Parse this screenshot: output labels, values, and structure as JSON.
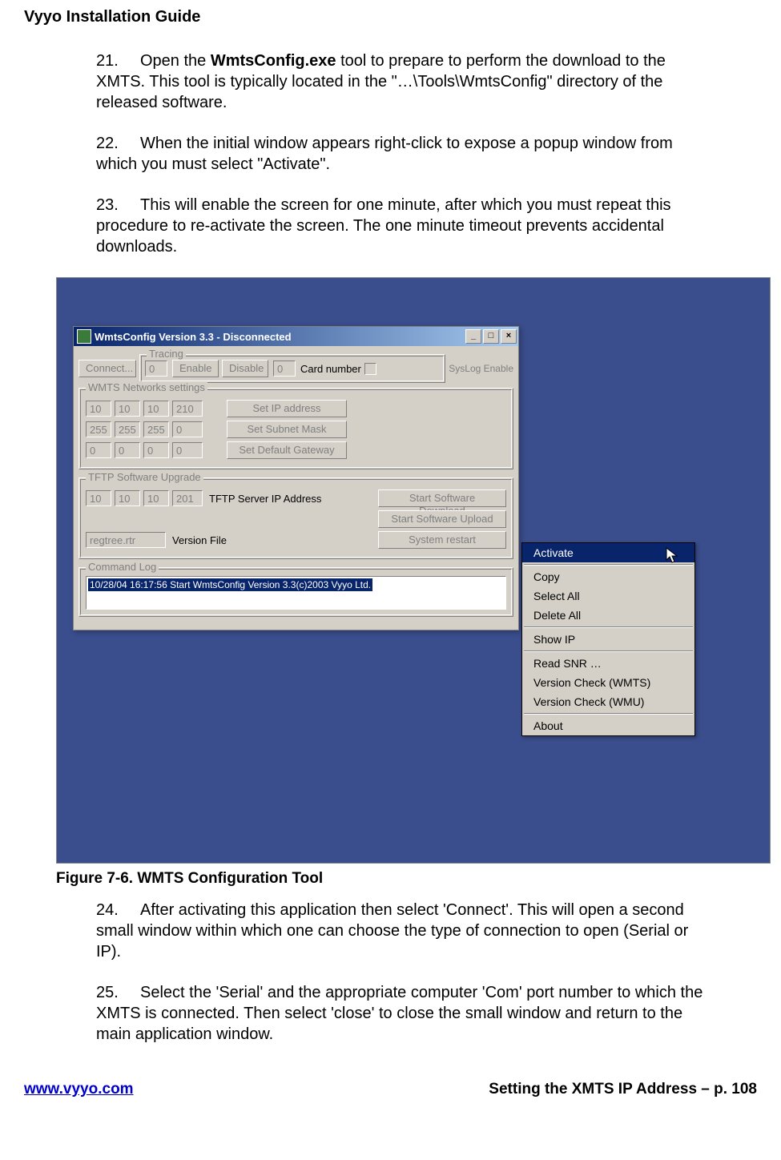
{
  "header_title": "Vyyo Installation Guide",
  "items": {
    "i21_num": "21.",
    "i21_a": "Open the ",
    "i21_bold": "WmtsConfig.exe",
    "i21_b": " tool to prepare to perform the download to the XMTS.  This tool is typically located in the \"…\\Tools\\WmtsConfig\" directory of the released software.",
    "i22_num": "22.",
    "i22": "When the initial window appears right-click to expose a popup window from which you must select \"Activate\".",
    "i23_num": "23.",
    "i23": "This will enable the screen for one minute, after which you must repeat this procedure to re-activate the screen. The one minute timeout prevents accidental downloads.",
    "i24_num": "24.",
    "i24": "After activating this application then select 'Connect'. This will open a second small window within which one can choose the type of connection to open (Serial or IP).",
    "i25_num": "25.",
    "i25": "Select the 'Serial' and the appropriate computer 'Com' port number to which the XMTS is connected. Then select 'close' to close the small window and return to the main application window."
  },
  "figure_caption": "Figure 7-6. WMTS Configuration Tool",
  "footer_link": "www.vyyo.com",
  "footer_right": "Setting the XMTS IP Address – p. 108",
  "win": {
    "title": "WmtsConfig Version 3.3 - Disconnected",
    "connect": "Connect...",
    "tracing_label": "Tracing",
    "tracing_val": "0",
    "enable": "Enable",
    "disable": "Disable",
    "cardnum_val": "0",
    "cardnum_label": "Card number",
    "syslog": "SysLog Enable",
    "net_label": "WMTS Networks settings",
    "ip1": "10",
    "ip2": "10",
    "ip3": "10",
    "ip4": "210",
    "set_ip": "Set IP address",
    "sm1": "255",
    "sm2": "255",
    "sm3": "255",
    "sm4": "0",
    "set_sm": "Set Subnet Mask",
    "gw1": "0",
    "gw2": "0",
    "gw3": "0",
    "gw4": "0",
    "set_gw": "Set Default Gateway",
    "tftp_label": "TFTP Software Upgrade",
    "t1": "10",
    "t2": "10",
    "t3": "10",
    "t4": "201",
    "tftp_ip_label": "TFTP Server IP Address",
    "start_dl": "Start Software Download",
    "start_ul": "Start Software Upload",
    "verfile": "regtree.rtr",
    "verfile_label": "Version File",
    "sysrestart": "System restart",
    "cmdlog_label": "Command Log",
    "cmdlog_entry": "10/28/04 16:17:56 Start WmtsConfig Version 3.3(c)2003 Vyyo Ltd."
  },
  "ctx": {
    "activate": "Activate",
    "copy": "Copy",
    "selectall": "Select All",
    "deleteall": "Delete All",
    "showip": "Show IP",
    "readsnr": "Read SNR …",
    "vc_wmts": "Version Check (WMTS)",
    "vc_wmu": "Version Check (WMU)",
    "about": "About"
  }
}
